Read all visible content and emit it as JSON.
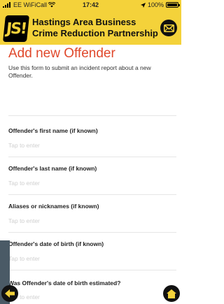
{
  "status_bar": {
    "carrier": "EE WiFiCall",
    "time": "17:42",
    "battery": "100%"
  },
  "header": {
    "logo_text": "JS!",
    "org_line1": "Hastings Area Business",
    "org_line2": "Crime Reduction Partnership"
  },
  "page": {
    "title": "Add new Offender",
    "intro": "Use this form to submit an incident report about a new Offender."
  },
  "fields": [
    {
      "label": "Offender's first name (if known)",
      "placeholder": "Tap to enter"
    },
    {
      "label": "Offender's last name (if known)",
      "placeholder": "Tap to enter"
    },
    {
      "label": "Aliases or nicknames (if known)",
      "placeholder": "Tap to enter"
    },
    {
      "label": "Offender's date of birth (if known)",
      "placeholder": "Tap to enter"
    },
    {
      "label": "Was Offender's date of birth estimated?",
      "placeholder": "Tap to enter"
    }
  ],
  "icons": {
    "mail": "mail-icon",
    "back": "back-arrow-icon",
    "home": "home-icon",
    "wifi": "wifi-icon",
    "location": "location-arrow-icon"
  },
  "colors": {
    "header": "#f4d23a",
    "title": "#e0482b",
    "nav_button": "#111111",
    "nav_glyph": "#f4d23a"
  }
}
